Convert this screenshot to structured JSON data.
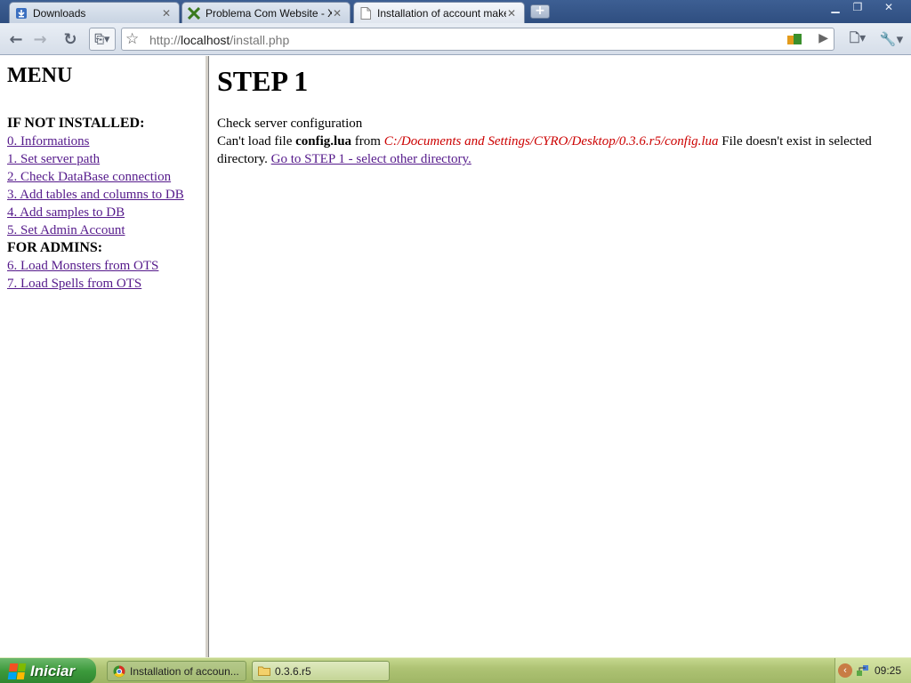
{
  "browser": {
    "tabs": [
      {
        "label": "Downloads",
        "icon": "download-icon",
        "active": false
      },
      {
        "label": "Problema Com Website - X...",
        "icon": "xenforo-x-icon",
        "active": false
      },
      {
        "label": "Installation of account maker",
        "icon": "page-icon",
        "active": true
      }
    ],
    "new_tab_glyph": "+",
    "url_prefix": "http://",
    "url_host": "localhost",
    "url_path": "/install.php"
  },
  "menu": {
    "title": "MENU",
    "section_not_installed": "IF NOT INSTALLED:",
    "links_not_installed": [
      "0. Informations",
      "1. Set server path",
      "2. Check DataBase connection",
      "3. Add tables and columns to DB",
      "4. Add samples to DB",
      "5. Set Admin Account"
    ],
    "section_admins": "FOR ADMINS:",
    "links_admins": [
      "6. Load Monsters from OTS",
      "7. Load Spells from OTS"
    ]
  },
  "content": {
    "heading": "STEP 1",
    "check_line": "Check server configuration",
    "cant_load_prefix": "Can't load file ",
    "file_name": "config.lua",
    "from_word": " from ",
    "path": "C:/Documents and Settings/CYRO/Desktop/0.3.6.r5/config.lua",
    "not_exist": " File doesn't exist in selected directory. ",
    "go_link": "Go to STEP 1 - select other directory."
  },
  "taskbar": {
    "start_label": "Iniciar",
    "tasks": [
      {
        "label": "Installation of accoun...",
        "icon": "chrome-icon",
        "active": true
      },
      {
        "label": "0.3.6.r5",
        "icon": "folder-icon",
        "active": false
      }
    ],
    "clock": "09:25"
  },
  "colors": {
    "visited_link": "#551a8b",
    "path_red": "#cc0000",
    "taskbar_green": "#aec374",
    "start_green": "#3c9a3c"
  }
}
